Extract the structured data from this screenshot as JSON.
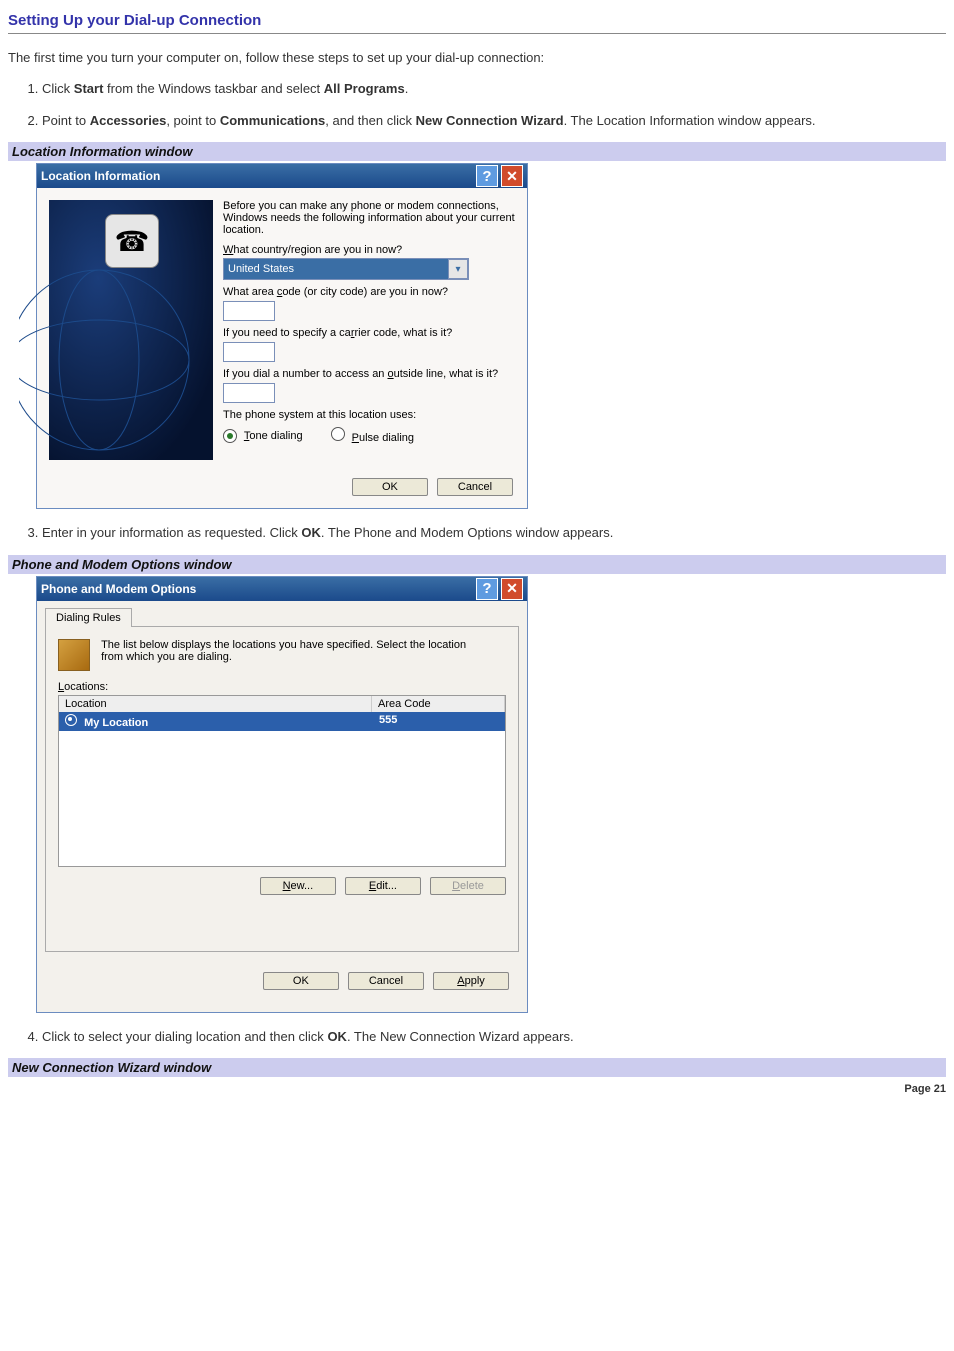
{
  "heading": "Setting Up your Dial-up Connection",
  "intro": "The first time you turn your computer on, follow these steps to set up your dial-up connection:",
  "steps": {
    "s1a": "Click ",
    "s1b": "Start",
    "s1c": " from the Windows taskbar and select ",
    "s1d": "All Programs",
    "s1e": ".",
    "s2a": "Point to ",
    "s2b": "Accessories",
    "s2c": ", point to ",
    "s2d": "Communications",
    "s2e": ", and then click ",
    "s2f": "New Connection Wizard",
    "s2g": ". The Location Information window appears.",
    "s3a": "Enter in your information as requested. Click ",
    "s3b": "OK",
    "s3c": ". The Phone and Modem Options window appears.",
    "s4a": "Click to select your dialing location and then click ",
    "s4b": "OK",
    "s4c": ". The New Connection Wizard appears."
  },
  "cap1": "Location Information window",
  "cap2": "Phone and Modem Options window",
  "cap3": "New Connection Wizard window",
  "dlg1": {
    "title": "Location Information",
    "help": "?",
    "close": "✕",
    "desc": "Before you can make any phone or modem connections, Windows needs the following information about your current location.",
    "q_country_pre": "W",
    "q_country_post": "hat country/region are you in now?",
    "country_value": "United States",
    "q_area_pre": "What area ",
    "q_area_u": "c",
    "q_area_post": "ode (or city code) are you in now?",
    "q_carrier_pre": "If you need to specify a ca",
    "q_carrier_u": "r",
    "q_carrier_post": "rier code, what is it?",
    "q_outside_pre": "If you dial a number to access an ",
    "q_outside_u": "o",
    "q_outside_post": "utside line, what is it?",
    "q_phone_sys": "The phone system at this location uses:",
    "radio_tone_u": "T",
    "radio_tone_rest": "one dialing",
    "radio_pulse_u": "P",
    "radio_pulse_rest": "ulse dialing",
    "ok": "OK",
    "cancel": "Cancel"
  },
  "dlg2": {
    "title": "Phone and Modem Options",
    "help": "?",
    "close": "✕",
    "tab": "Dialing Rules",
    "desc": "The list below displays the locations you have specified. Select the location from which you are dialing.",
    "loc_label_u": "L",
    "loc_label_rest": "ocations:",
    "col_location": "Location",
    "col_area": "Area Code",
    "row1_name": "My Location",
    "row1_area": "555",
    "new_u": "N",
    "new_rest": "ew...",
    "edit_u": "E",
    "edit_rest": "dit...",
    "del_u": "D",
    "del_rest": "elete",
    "ok": "OK",
    "cancel": "Cancel",
    "apply_u": "A",
    "apply_rest": "pply"
  },
  "page": "Page 21"
}
